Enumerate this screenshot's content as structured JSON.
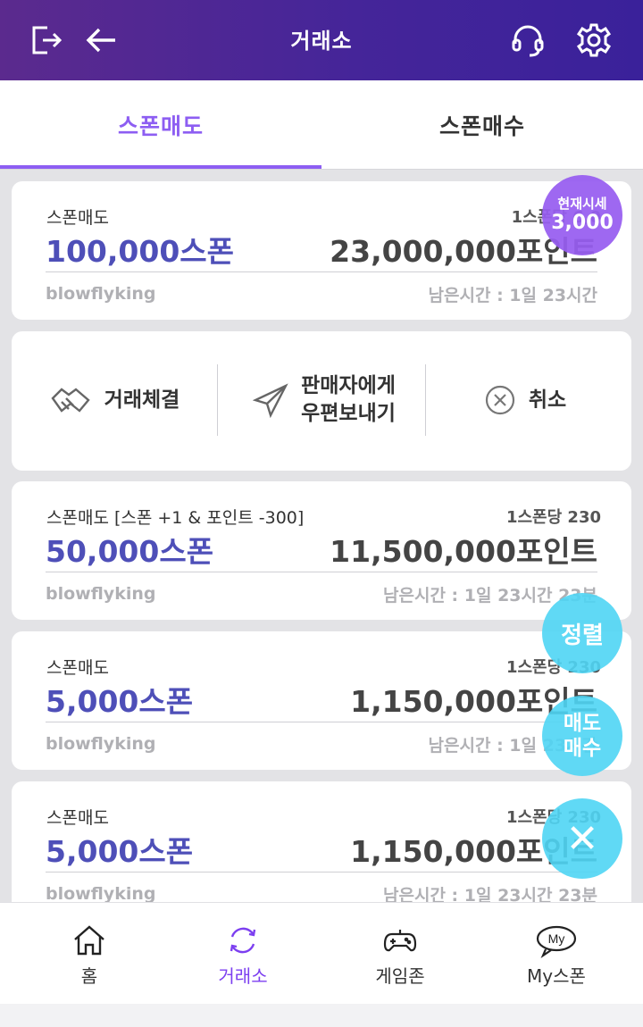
{
  "header": {
    "title": "거래소"
  },
  "tabs": [
    {
      "label": "스폰매도"
    },
    {
      "label": "스폰매수"
    }
  ],
  "price_badge": {
    "label": "현재시세",
    "value": "3,000"
  },
  "cards": [
    {
      "kind": "스폰매도",
      "rate": "1스폰당 6,0",
      "qty": "100,000스폰",
      "points": "23,000,000포인트",
      "seller": "blowflyking",
      "remain": "남은시간 : 1일 23시간"
    },
    {
      "kind": "스폰매도 [스폰 +1 & 포인트 -300]",
      "rate": "1스폰당 230",
      "qty": "50,000스폰",
      "points": "11,500,000포인트",
      "seller": "blowflyking",
      "remain": "남은시간 : 1일 23시간 23분"
    },
    {
      "kind": "스폰매도",
      "rate": "1스폰당 230",
      "qty": "5,000스폰",
      "points": "1,150,000포인트",
      "seller": "blowflyking",
      "remain": "남은시간 : 1일 23시간"
    },
    {
      "kind": "스폰매도",
      "rate": "1스폰당 230",
      "qty": "5,000스폰",
      "points": "1,150,000포인트",
      "seller": "blowflyking",
      "remain": "남은시간 : 1일 23시간 23분"
    }
  ],
  "actions": {
    "deal": "거래체결",
    "mail_line1": "판매자에게",
    "mail_line2": "우편보내기",
    "cancel": "취소"
  },
  "fabs": {
    "sort": "정렬",
    "trade_line1": "매도",
    "trade_line2": "매수",
    "close": "✕"
  },
  "nav": [
    {
      "label": "홈",
      "icon": "home-icon"
    },
    {
      "label": "거래소",
      "icon": "exchange-icon"
    },
    {
      "label": "게임존",
      "icon": "gamepad-icon"
    },
    {
      "label": "My스폰",
      "icon": "my-icon"
    }
  ],
  "colors": {
    "header": "#452599",
    "accent": "#8d5ef2",
    "quantity": "#4e4fb8",
    "fab": "#4fd5f4"
  }
}
